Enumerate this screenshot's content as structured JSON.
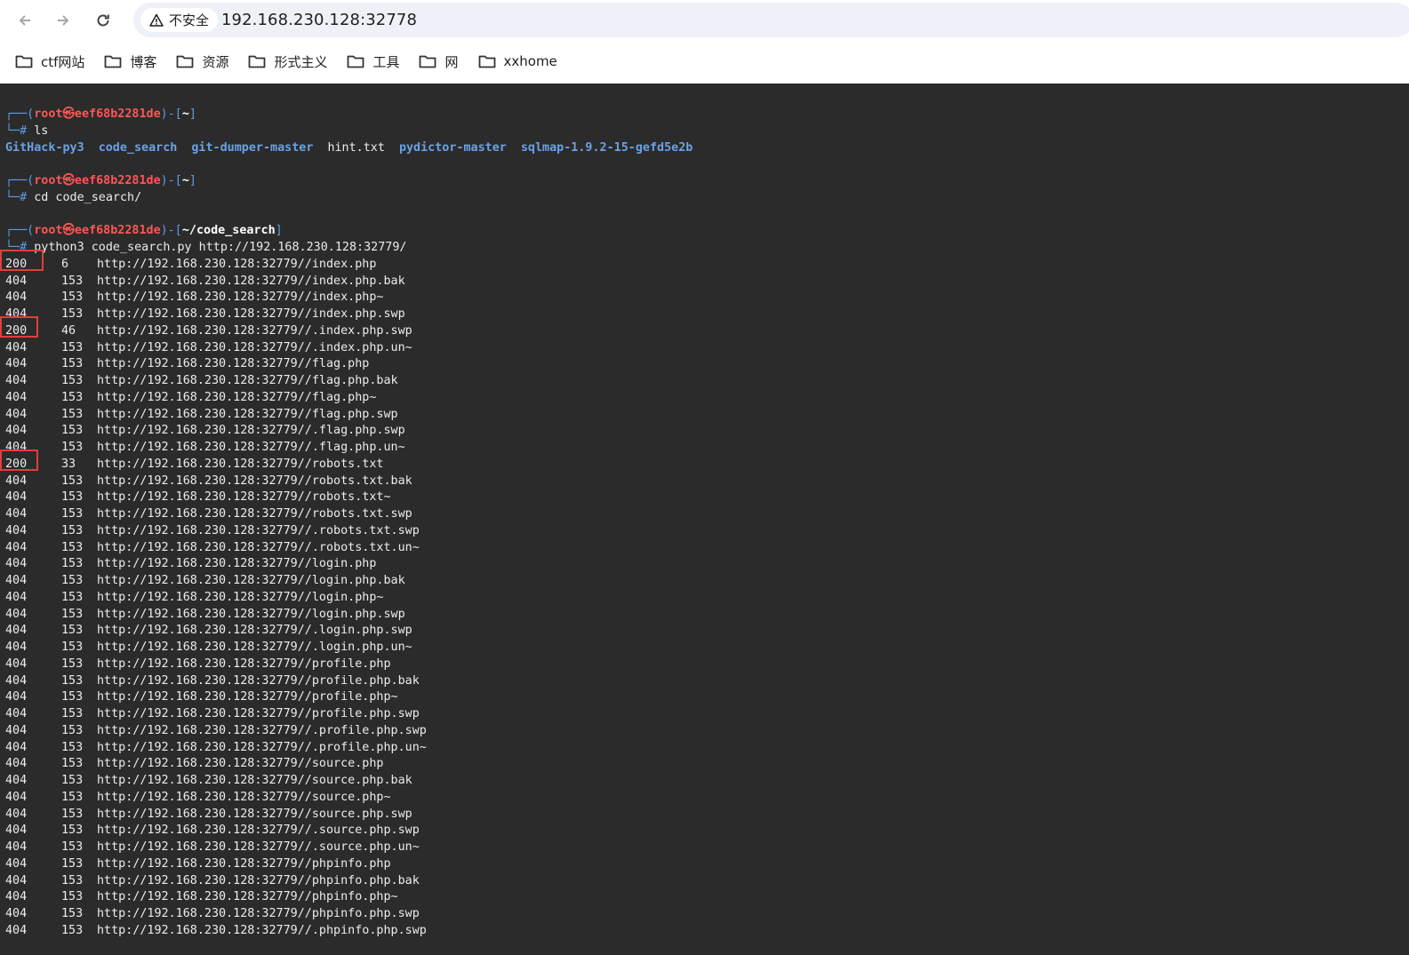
{
  "browser": {
    "security_label": "不安全",
    "url": "192.168.230.128:32778",
    "bookmarks": [
      "ctf网站",
      "博客",
      "资源",
      "形式主义",
      "工具",
      "网",
      "xxhome"
    ]
  },
  "terminal": {
    "prompt": {
      "user": "root㉿eef68b2281de",
      "prefix": "┌──(",
      "mid": ")-[",
      "end": "]",
      "hash_line": "└─#"
    },
    "block1": {
      "dir": "~",
      "command": "ls"
    },
    "ls_output": [
      "GitHack-py3",
      "code_search",
      "git-dumper-master",
      "hint.txt",
      "pydictor-master",
      "sqlmap-1.9.2-15-gefd5e2b"
    ],
    "block2": {
      "dir": "~",
      "command": "cd code_search/"
    },
    "block3": {
      "dir": "~/code_search",
      "command": "python3 code_search.py http://192.168.230.128:32779/"
    },
    "results": [
      {
        "code": "200",
        "size": "6",
        "url": "http://192.168.230.128:32779//index.php",
        "highlight": true
      },
      {
        "code": "404",
        "size": "153",
        "url": "http://192.168.230.128:32779//index.php.bak"
      },
      {
        "code": "404",
        "size": "153",
        "url": "http://192.168.230.128:32779//index.php~"
      },
      {
        "code": "404",
        "size": "153",
        "url": "http://192.168.230.128:32779//index.php.swp"
      },
      {
        "code": "200",
        "size": "46",
        "url": "http://192.168.230.128:32779//.index.php.swp",
        "highlight": true
      },
      {
        "code": "404",
        "size": "153",
        "url": "http://192.168.230.128:32779//.index.php.un~"
      },
      {
        "code": "404",
        "size": "153",
        "url": "http://192.168.230.128:32779//flag.php"
      },
      {
        "code": "404",
        "size": "153",
        "url": "http://192.168.230.128:32779//flag.php.bak"
      },
      {
        "code": "404",
        "size": "153",
        "url": "http://192.168.230.128:32779//flag.php~"
      },
      {
        "code": "404",
        "size": "153",
        "url": "http://192.168.230.128:32779//flag.php.swp"
      },
      {
        "code": "404",
        "size": "153",
        "url": "http://192.168.230.128:32779//.flag.php.swp"
      },
      {
        "code": "404",
        "size": "153",
        "url": "http://192.168.230.128:32779//.flag.php.un~"
      },
      {
        "code": "200",
        "size": "33",
        "url": "http://192.168.230.128:32779//robots.txt",
        "highlight": true
      },
      {
        "code": "404",
        "size": "153",
        "url": "http://192.168.230.128:32779//robots.txt.bak"
      },
      {
        "code": "404",
        "size": "153",
        "url": "http://192.168.230.128:32779//robots.txt~"
      },
      {
        "code": "404",
        "size": "153",
        "url": "http://192.168.230.128:32779//robots.txt.swp"
      },
      {
        "code": "404",
        "size": "153",
        "url": "http://192.168.230.128:32779//.robots.txt.swp"
      },
      {
        "code": "404",
        "size": "153",
        "url": "http://192.168.230.128:32779//.robots.txt.un~"
      },
      {
        "code": "404",
        "size": "153",
        "url": "http://192.168.230.128:32779//login.php"
      },
      {
        "code": "404",
        "size": "153",
        "url": "http://192.168.230.128:32779//login.php.bak"
      },
      {
        "code": "404",
        "size": "153",
        "url": "http://192.168.230.128:32779//login.php~"
      },
      {
        "code": "404",
        "size": "153",
        "url": "http://192.168.230.128:32779//login.php.swp"
      },
      {
        "code": "404",
        "size": "153",
        "url": "http://192.168.230.128:32779//.login.php.swp"
      },
      {
        "code": "404",
        "size": "153",
        "url": "http://192.168.230.128:32779//.login.php.un~"
      },
      {
        "code": "404",
        "size": "153",
        "url": "http://192.168.230.128:32779//profile.php"
      },
      {
        "code": "404",
        "size": "153",
        "url": "http://192.168.230.128:32779//profile.php.bak"
      },
      {
        "code": "404",
        "size": "153",
        "url": "http://192.168.230.128:32779//profile.php~"
      },
      {
        "code": "404",
        "size": "153",
        "url": "http://192.168.230.128:32779//profile.php.swp"
      },
      {
        "code": "404",
        "size": "153",
        "url": "http://192.168.230.128:32779//.profile.php.swp"
      },
      {
        "code": "404",
        "size": "153",
        "url": "http://192.168.230.128:32779//.profile.php.un~"
      },
      {
        "code": "404",
        "size": "153",
        "url": "http://192.168.230.128:32779//source.php"
      },
      {
        "code": "404",
        "size": "153",
        "url": "http://192.168.230.128:32779//source.php.bak"
      },
      {
        "code": "404",
        "size": "153",
        "url": "http://192.168.230.128:32779//source.php~"
      },
      {
        "code": "404",
        "size": "153",
        "url": "http://192.168.230.128:32779//source.php.swp"
      },
      {
        "code": "404",
        "size": "153",
        "url": "http://192.168.230.128:32779//.source.php.swp"
      },
      {
        "code": "404",
        "size": "153",
        "url": "http://192.168.230.128:32779//.source.php.un~"
      },
      {
        "code": "404",
        "size": "153",
        "url": "http://192.168.230.128:32779//phpinfo.php"
      },
      {
        "code": "404",
        "size": "153",
        "url": "http://192.168.230.128:32779//phpinfo.php.bak"
      },
      {
        "code": "404",
        "size": "153",
        "url": "http://192.168.230.128:32779//phpinfo.php~"
      },
      {
        "code": "404",
        "size": "153",
        "url": "http://192.168.230.128:32779//phpinfo.php.swp"
      },
      {
        "code": "404",
        "size": "153",
        "url": "http://192.168.230.128:32779//.phpinfo.php.swp"
      }
    ]
  },
  "colors": {
    "terminal_bg": "#2b2b2b",
    "prompt_red": "#ff5555",
    "prompt_blue": "#5c9de8",
    "dir_blue": "#6aa2e6",
    "highlight_box": "#e0403a"
  }
}
